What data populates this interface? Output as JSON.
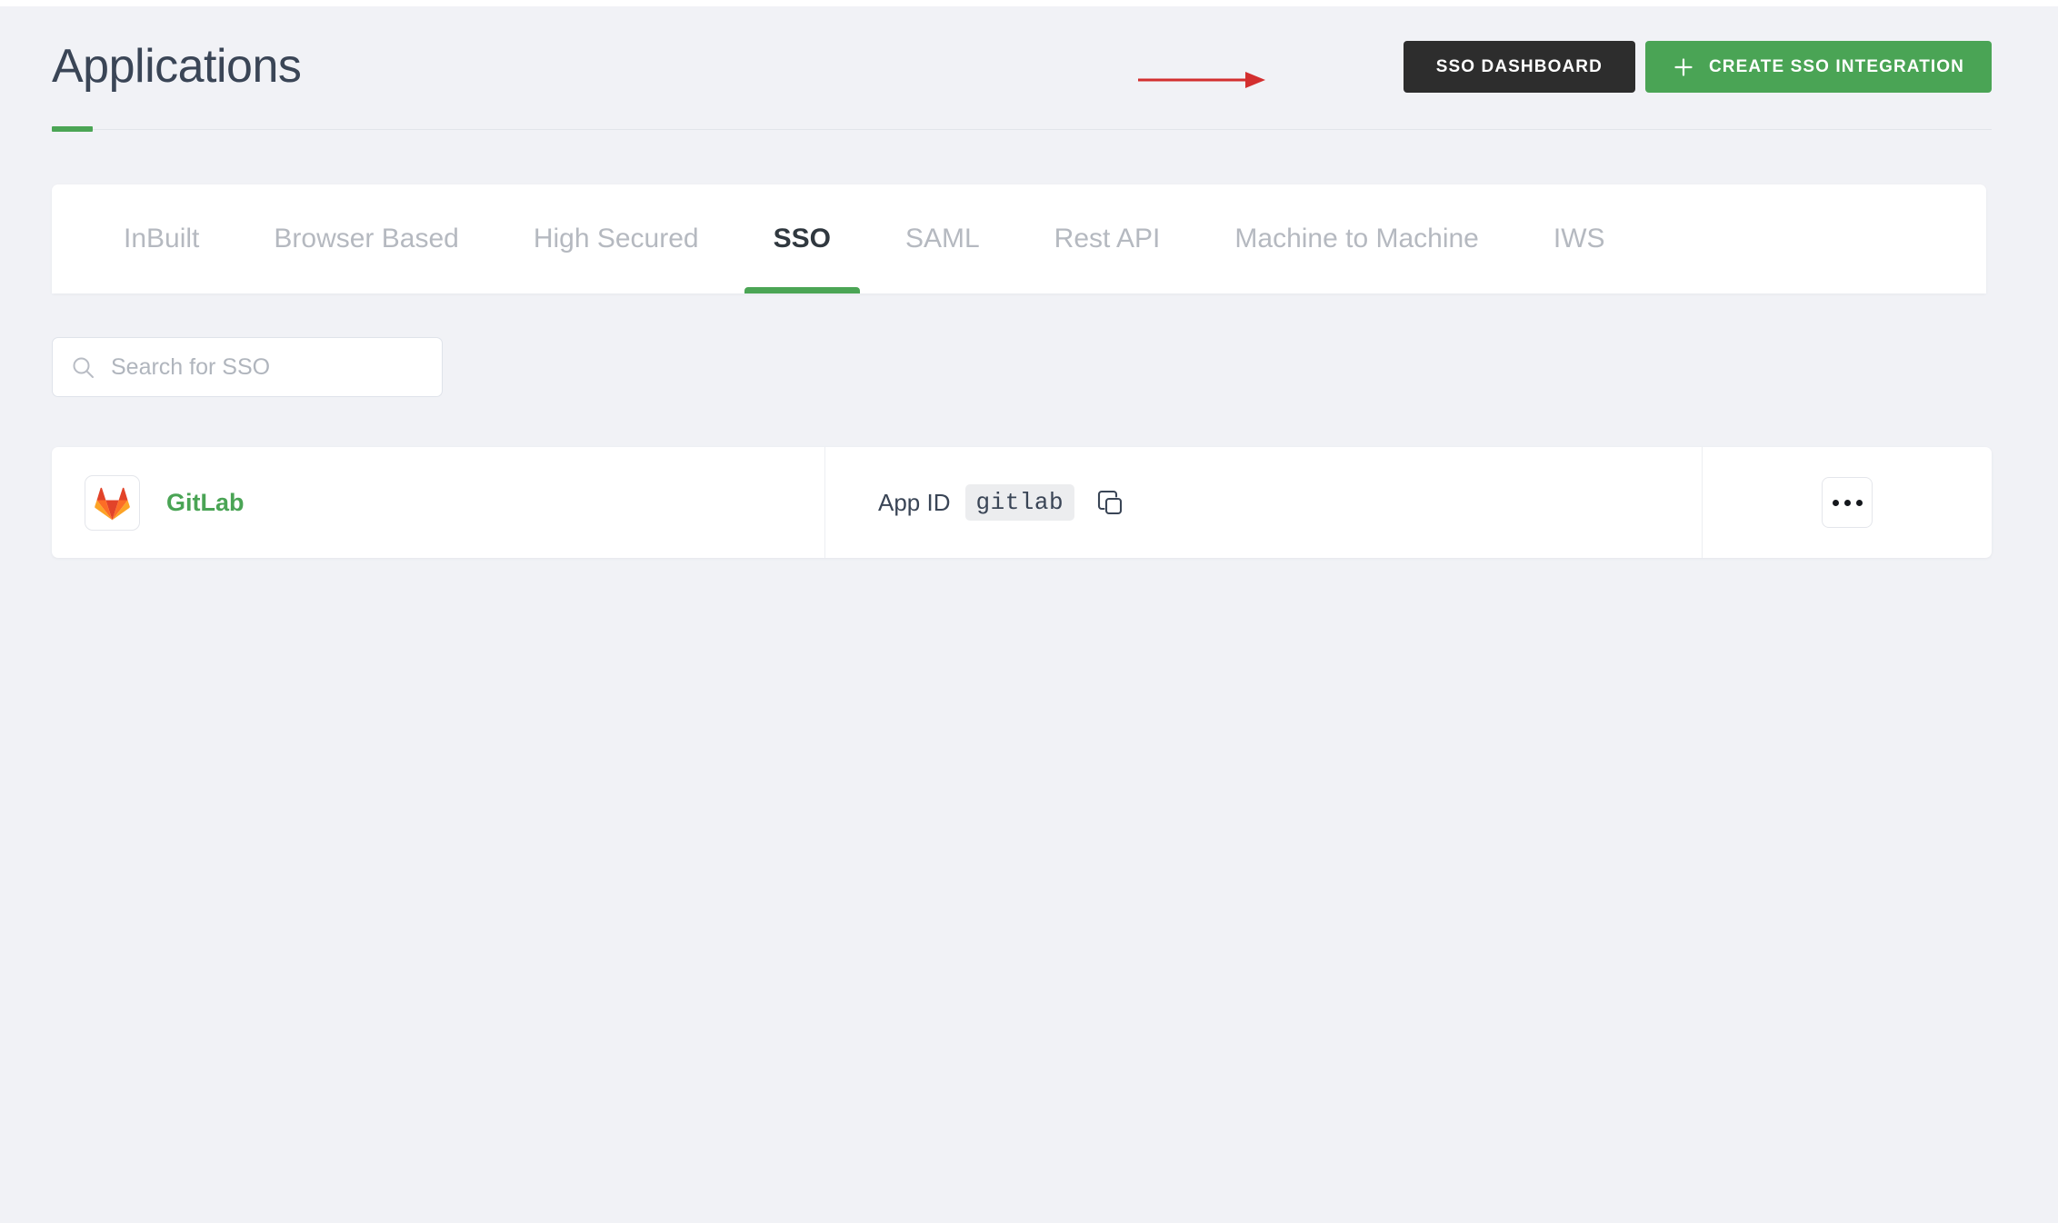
{
  "header": {
    "title": "Applications",
    "accent_color": "#4ba555",
    "actions": [
      {
        "label": "SSO DASHBOARD",
        "style": "dark",
        "icon": null
      },
      {
        "label": "CREATE SSO INTEGRATION",
        "style": "green",
        "icon": "plus-icon"
      }
    ],
    "annotation": {
      "shape": "arrow-right",
      "color": "#d32f2f",
      "points_to": "SSO DASHBOARD"
    }
  },
  "tabs": [
    {
      "label": "InBuilt",
      "active": false
    },
    {
      "label": "Browser Based",
      "active": false
    },
    {
      "label": "High Secured",
      "active": false
    },
    {
      "label": "SSO",
      "active": true
    },
    {
      "label": "SAML",
      "active": false
    },
    {
      "label": "Rest API",
      "active": false
    },
    {
      "label": "Machine to Machine",
      "active": false
    },
    {
      "label": "IWS",
      "active": false
    }
  ],
  "search": {
    "placeholder": "Search for SSO",
    "value": "",
    "icon": "search-icon"
  },
  "list": {
    "rows": [
      {
        "app_name": "GitLab",
        "app_logo": "gitlab-logo",
        "app_id_label": "App ID",
        "app_id_value": "gitlab",
        "copy_icon": "copy-icon",
        "menu_icon": "kebab-menu-icon"
      }
    ]
  },
  "colors": {
    "background": "#f1f2f6",
    "accent_green": "#4ba555",
    "button_dark": "#2d2d2d",
    "button_green": "#4aa455",
    "title_text": "#3a4556",
    "tab_inactive": "#b5b9c0",
    "annotation_red": "#d32f2f"
  }
}
